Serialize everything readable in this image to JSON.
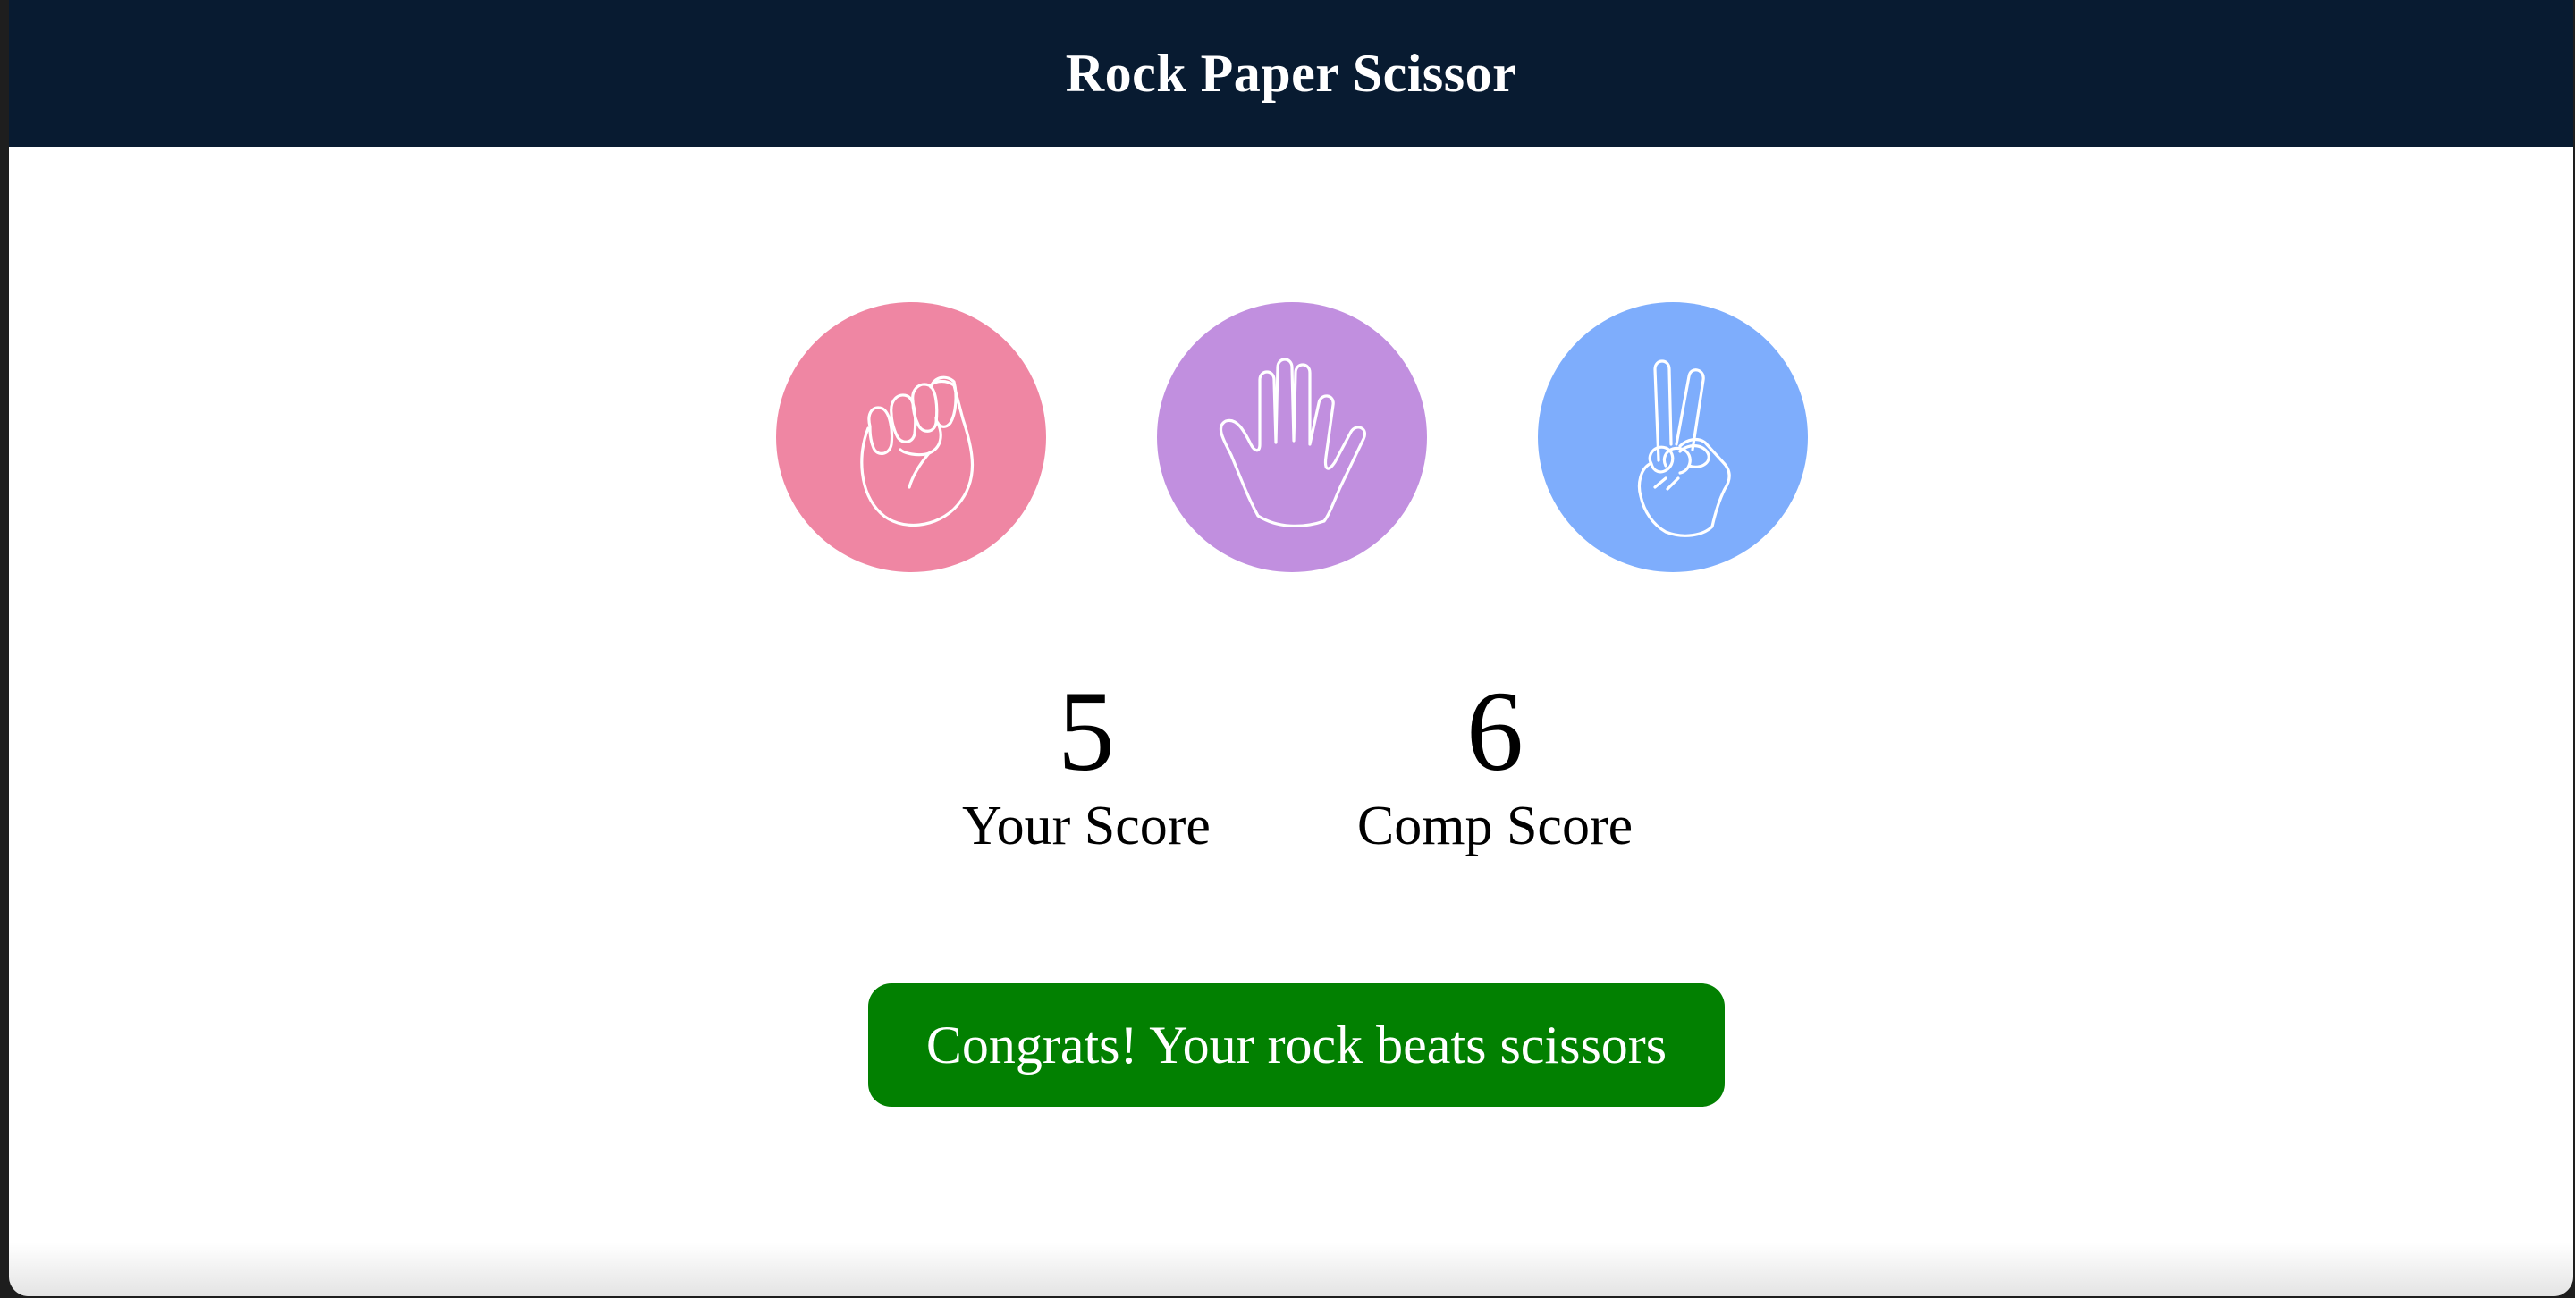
{
  "header": {
    "title": "Rock Paper Scissor"
  },
  "choices": [
    {
      "id": "rock",
      "icon": "rock-hand-icon",
      "color": "#ef86a3"
    },
    {
      "id": "paper",
      "icon": "paper-hand-icon",
      "color": "#c18fdf"
    },
    {
      "id": "scissors",
      "icon": "scissors-hand-icon",
      "color": "#7eadfc"
    }
  ],
  "scoreboard": {
    "user_score": "5",
    "user_label": "Your Score",
    "comp_score": "6",
    "comp_label": "Comp Score"
  },
  "message": {
    "text": "Congrats! Your rock beats scissors",
    "background": "#028001"
  },
  "colors": {
    "header_bg": "#081b31"
  }
}
